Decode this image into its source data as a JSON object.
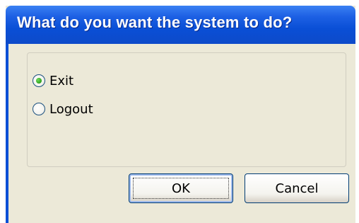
{
  "dialog": {
    "title": "What do you want the system to do?",
    "options": [
      {
        "label": "Exit",
        "selected": true
      },
      {
        "label": "Logout",
        "selected": false
      }
    ],
    "buttons": {
      "ok_label": "OK",
      "cancel_label": "Cancel"
    },
    "colors": {
      "titlebar": "#0a4fd6",
      "body": "#ece9d8",
      "radio_dot": "#2ea11c"
    }
  }
}
